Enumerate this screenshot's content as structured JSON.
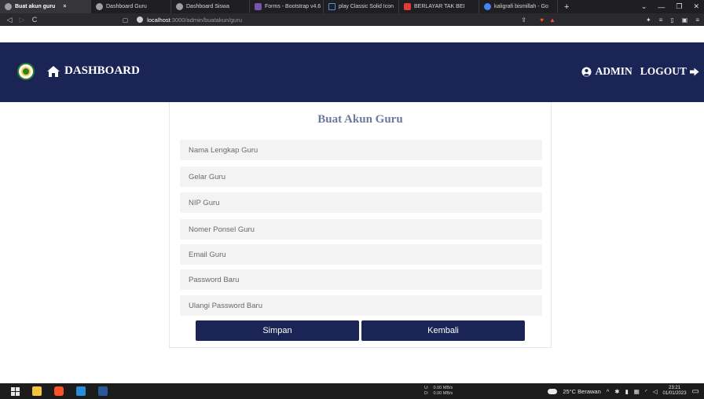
{
  "browser": {
    "tabs": [
      {
        "title": "Buat akun guru",
        "active": true,
        "icon_color": "#9aa0a6"
      },
      {
        "title": "Dashboard Guru",
        "active": false,
        "icon_color": "#9aa0a6"
      },
      {
        "title": "Dashboard Siswa",
        "active": false,
        "icon_color": "#9aa0a6"
      },
      {
        "title": "Forms - Bootstrap v4.6",
        "active": false,
        "icon_color": "#7952b3"
      },
      {
        "title": "play Classic Solid Icon",
        "active": false,
        "icon_color": "#2b6cb0"
      },
      {
        "title": "BERLAYAR TAK BEI",
        "active": false,
        "icon_color": "#e53935"
      },
      {
        "title": "kaligrafi bismillah - Go",
        "active": false,
        "icon_color": "#4285f4"
      }
    ],
    "close_tab_symbol": "×",
    "url_host": "localhost",
    "url_path": ":3000/admin/buatakun/guru"
  },
  "navbar": {
    "brand_label": "DASHBOARD",
    "admin_label": "ADMIN",
    "logout_label": "LOGOUT",
    "bg_color": "#1b2555"
  },
  "form": {
    "title": "Buat Akun Guru",
    "fields": [
      {
        "name": "nama-lengkap-guru-input",
        "placeholder": "Nama Lengkap Guru",
        "type": "text"
      },
      {
        "name": "gelar-guru-input",
        "placeholder": "Gelar Guru",
        "type": "text"
      },
      {
        "name": "nip-guru-input",
        "placeholder": "NIP Guru",
        "type": "text"
      },
      {
        "name": "nomer-ponsel-guru-input",
        "placeholder": "Nomer Ponsel Guru",
        "type": "text"
      },
      {
        "name": "email-guru-input",
        "placeholder": "Email Guru",
        "type": "email"
      },
      {
        "name": "password-baru-input",
        "placeholder": "Password Baru",
        "type": "password"
      },
      {
        "name": "ulangi-password-baru-input",
        "placeholder": "Ulangi Password Baru",
        "type": "password"
      }
    ],
    "save_label": "Simpan",
    "back_label": "Kembali"
  },
  "taskbar": {
    "net_upload_label": "U:",
    "net_upload": "0.00 MB/s",
    "net_download_label": "D:",
    "net_download": "0.00 MB/s",
    "weather": "25°C Berawan",
    "time": "23:21",
    "date": "01/01/2023"
  }
}
